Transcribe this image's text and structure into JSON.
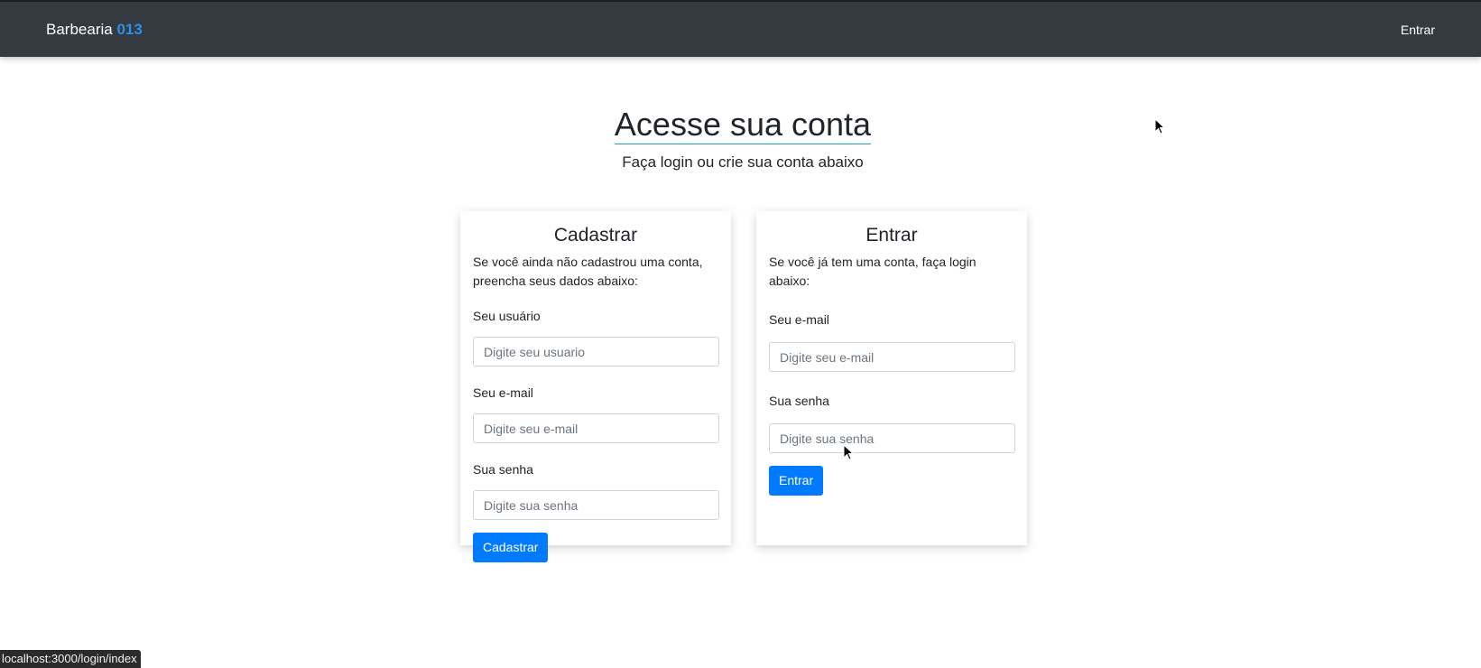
{
  "navbar": {
    "brand_text": "Barbearia",
    "brand_accent": "013",
    "login_link": "Entrar"
  },
  "hero": {
    "title": "Acesse sua conta",
    "subtitle": "Faça login ou crie sua conta abaixo"
  },
  "register": {
    "title": "Cadastrar",
    "description": "Se você ainda não cadastrou uma conta, preencha seus dados abaixo:",
    "username_label": "Seu usuário",
    "username_placeholder": "Digite seu usuario",
    "email_label": "Seu e-mail",
    "email_placeholder": "Digite seu e-mail",
    "password_label": "Sua senha",
    "password_placeholder": "Digite sua senha",
    "submit_label": "Cadastrar"
  },
  "login": {
    "title": "Entrar",
    "description": "Se você já tem uma conta, faça login abaixo:",
    "email_label": "Seu e-mail",
    "email_placeholder": "Digite seu e-mail",
    "password_label": "Sua senha",
    "password_placeholder": "Digite sua senha",
    "submit_label": "Entrar"
  },
  "status_bar": {
    "url": "localhost:3000/login/index"
  },
  "colors": {
    "navbar_bg": "#343a40",
    "brand_accent": "#2f8fe6",
    "primary_button": "#007bff",
    "title_underline": "#17a2b8"
  }
}
